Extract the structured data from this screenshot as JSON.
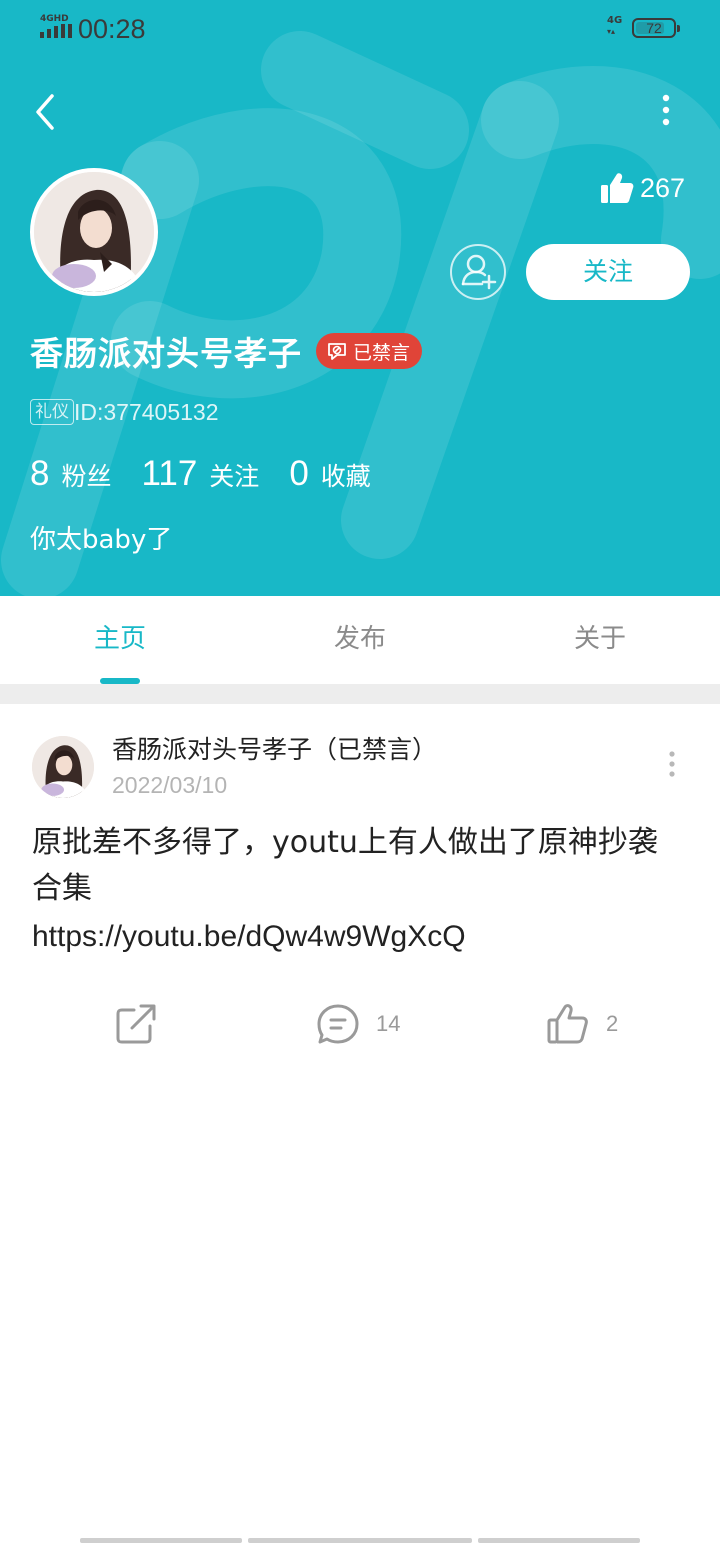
{
  "status_bar": {
    "network_tag": "4GHD",
    "time": "00:28",
    "network_right": "4G",
    "battery": "72"
  },
  "profile": {
    "likes": "267",
    "follow_label": "关注",
    "username": "香肠派对头号孝子",
    "banned_badge": "已禁言",
    "medal": "礼仪",
    "id_text": "ID:377405132",
    "stats": [
      {
        "num": "8",
        "label": "粉丝"
      },
      {
        "num": "117",
        "label": "关注"
      },
      {
        "num": "0",
        "label": "收藏"
      }
    ],
    "bio": "你太baby了"
  },
  "tabs": [
    "主页",
    "发布",
    "关于"
  ],
  "post": {
    "author": "香肠派对头号孝子（已禁言）",
    "date": "2022/03/10",
    "text": "原批差不多得了，youtu上有人做出了原神抄袭合集",
    "link": "https://youtu.be/dQw4w9WgXcQ",
    "comments": "14",
    "likes": "2"
  },
  "colors": {
    "accent": "#18b8c7",
    "banned": "#e04438"
  },
  "icons": [
    "back-icon",
    "more-icon",
    "thumb-up-icon",
    "add-friend-icon",
    "mute-icon",
    "share-icon",
    "comment-icon",
    "like-icon"
  ]
}
